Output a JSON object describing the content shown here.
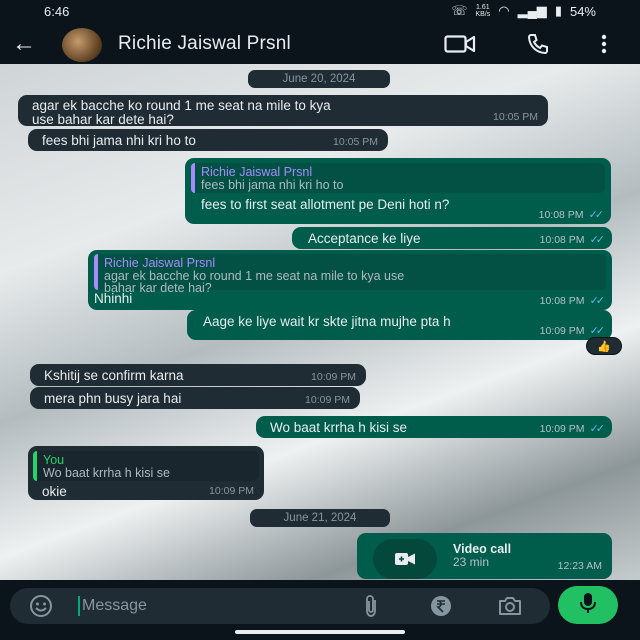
{
  "status": {
    "time": "6:46",
    "net_speed": "1.61",
    "net_unit": "KB/s",
    "battery": "54%"
  },
  "header": {
    "contact_name": "Richie Jaiswal Prsnl"
  },
  "dates": {
    "first": "June 20, 2024",
    "second": "June 21, 2024"
  },
  "messages": [
    {
      "dir": "in",
      "lines": [
        "agar ek bacche ko round 1 me seat na mile to kya",
        "use bahar kar dete hai?"
      ],
      "time": "10:05 PM"
    },
    {
      "dir": "in",
      "lines": [
        "fees bhi jama nhi kri ho to"
      ],
      "time": "10:05 PM"
    },
    {
      "dir": "out",
      "quote": {
        "name": "Richie Jaiswal Prsnl",
        "lines": [
          "fees bhi jama nhi kri ho to"
        ]
      },
      "lines": [
        "fees to first seat allotment pe Deni hoti n?"
      ],
      "time": "10:08 PM"
    },
    {
      "dir": "out",
      "lines": [
        "Acceptance ke liye"
      ],
      "time": "10:08 PM"
    },
    {
      "dir": "out",
      "quote": {
        "name": "Richie Jaiswal Prsnl",
        "lines": [
          "agar ek bacche ko round 1 me seat na mile to kya use",
          "bahar kar dete hai?"
        ]
      },
      "lines": [
        "Nhinhi"
      ],
      "time": "10:08 PM"
    },
    {
      "dir": "out",
      "lines": [
        "Aage ke liye wait kr skte jitna mujhe pta h"
      ],
      "time": "10:09 PM",
      "reaction": "👍"
    },
    {
      "dir": "in",
      "lines": [
        "Kshitij se confirm karna"
      ],
      "time": "10:09 PM"
    },
    {
      "dir": "in",
      "lines": [
        "mera phn busy jara hai"
      ],
      "time": "10:09 PM"
    },
    {
      "dir": "out",
      "lines": [
        "Wo baat krrha h kisi se"
      ],
      "time": "10:09 PM"
    },
    {
      "dir": "in",
      "quote": {
        "name": "You",
        "lines": [
          "Wo baat krrha h kisi se"
        ]
      },
      "lines": [
        "okie"
      ],
      "time": "10:09 PM"
    },
    {
      "dir": "out",
      "call": {
        "title": "Video call",
        "duration": "23 min"
      },
      "time": "12:23 AM"
    }
  ],
  "composer": {
    "placeholder": "Message"
  },
  "colors": {
    "incoming": "#1f2c34",
    "outgoing": "#005c4b",
    "accent": "#21c063",
    "read_ticks": "#53bdeb"
  },
  "icons": [
    "back-arrow-icon",
    "video-icon",
    "phone-icon",
    "more-icon",
    "emoji-icon",
    "attach-icon",
    "rupee-icon",
    "camera-icon",
    "mic-icon"
  ]
}
